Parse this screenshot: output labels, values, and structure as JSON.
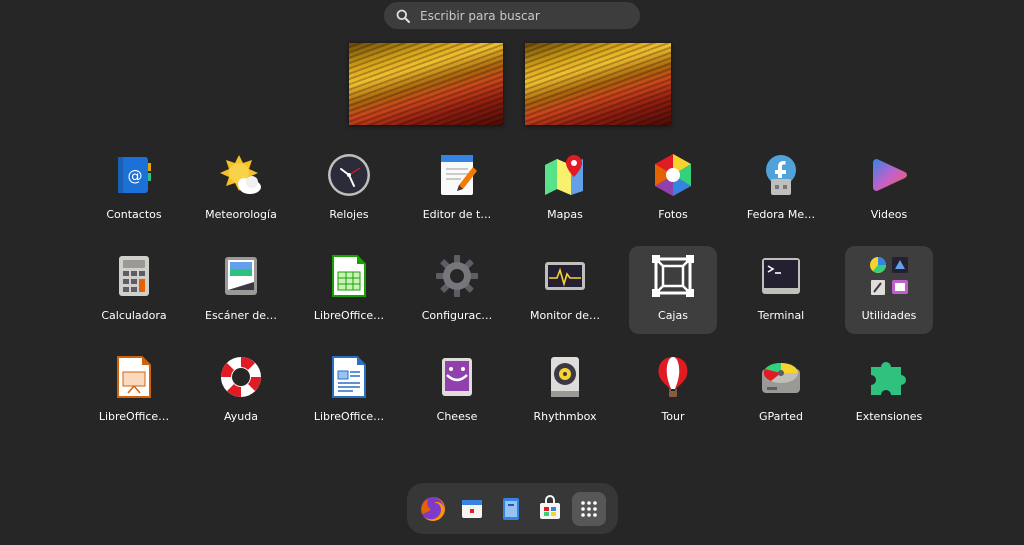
{
  "search": {
    "placeholder": "Escribir para buscar",
    "icon": "search-icon"
  },
  "workspaces": [
    "workspace-1",
    "workspace-2"
  ],
  "apps": [
    {
      "label": "Contactos",
      "icon": "contacts-icon"
    },
    {
      "label": "Meteorología",
      "icon": "weather-icon"
    },
    {
      "label": "Relojes",
      "icon": "clock-icon"
    },
    {
      "label": "Editor de t…",
      "icon": "text-editor-icon"
    },
    {
      "label": "Mapas",
      "icon": "maps-icon"
    },
    {
      "label": "Fotos",
      "icon": "photos-icon"
    },
    {
      "label": "Fedora Me…",
      "icon": "fedora-media-writer-icon"
    },
    {
      "label": "Videos",
      "icon": "videos-icon"
    },
    {
      "label": "Calculadora",
      "icon": "calculator-icon"
    },
    {
      "label": "Escáner de…",
      "icon": "scanner-icon"
    },
    {
      "label": "LibreOffice…",
      "icon": "libreoffice-calc-icon"
    },
    {
      "label": "Configurac…",
      "icon": "settings-gear-icon"
    },
    {
      "label": "Monitor de…",
      "icon": "system-monitor-icon"
    },
    {
      "label": "Cajas",
      "icon": "boxes-icon"
    },
    {
      "label": "Terminal",
      "icon": "terminal-icon"
    },
    {
      "label": "Utilidades",
      "icon": "utilities-folder-icon"
    },
    {
      "label": "LibreOffice…",
      "icon": "libreoffice-impress-icon"
    },
    {
      "label": "Ayuda",
      "icon": "help-lifebuoy-icon"
    },
    {
      "label": "LibreOffice…",
      "icon": "libreoffice-writer-icon"
    },
    {
      "label": "Cheese",
      "icon": "cheese-icon"
    },
    {
      "label": "Rhythmbox",
      "icon": "rhythmbox-icon"
    },
    {
      "label": "Tour",
      "icon": "tour-balloon-icon"
    },
    {
      "label": "GParted",
      "icon": "gparted-icon"
    },
    {
      "label": "Extensiones",
      "icon": "extensions-puzzle-icon"
    }
  ],
  "dock": [
    "firefox-icon",
    "calendar-icon",
    "files-icon",
    "software-icon",
    "app-grid-icon"
  ],
  "colors": {
    "background": "#262626",
    "selected_tile": "#3e3e3e",
    "dock": "#373737",
    "accent_blue": "#3584e4"
  }
}
